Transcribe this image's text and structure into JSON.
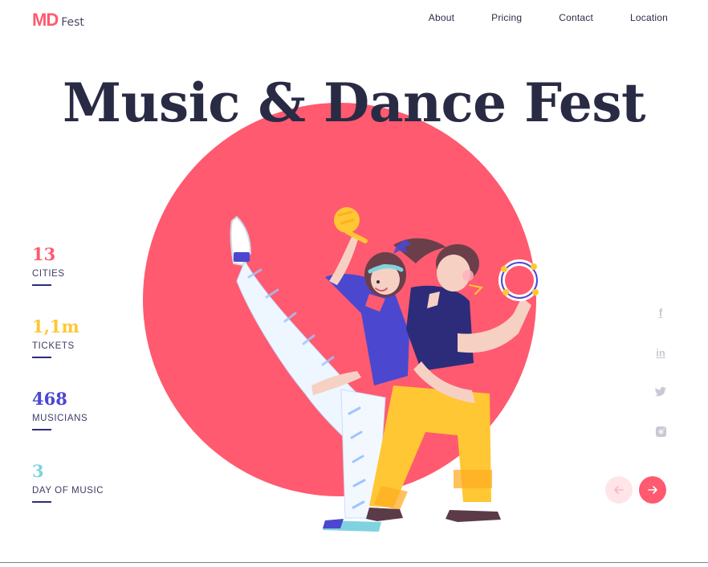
{
  "header": {
    "logo_mark": "MD",
    "logo_text": "Fest",
    "nav": [
      {
        "label": "About"
      },
      {
        "label": "Pricing"
      },
      {
        "label": "Contact"
      },
      {
        "label": "Location"
      }
    ]
  },
  "hero": {
    "title": "Music & Dance Fest"
  },
  "stats": [
    {
      "value": "13",
      "label": "CITIES",
      "color": "#ff5a6f"
    },
    {
      "value": "1,1m",
      "label": "TICKETS",
      "color": "#ffc733"
    },
    {
      "value": "468",
      "label": "MUSICIANS",
      "color": "#4b48cf"
    },
    {
      "value": "3",
      "label": "DAY OF MUSIC",
      "color": "#7fd3df"
    }
  ],
  "social": [
    {
      "name": "facebook-icon",
      "glyph": "f"
    },
    {
      "name": "linkedin-icon",
      "glyph": "in"
    },
    {
      "name": "twitter-icon",
      "glyph": "bird"
    },
    {
      "name": "instagram-icon",
      "glyph": "square"
    }
  ],
  "controls": {
    "prev_icon": "arrow-left-icon",
    "next_icon": "arrow-right-icon"
  },
  "colors": {
    "accent": "#ff5a6f",
    "title": "#292b45",
    "yellow": "#ffc733",
    "indigo": "#4b48cf",
    "teal": "#7fd3df"
  }
}
